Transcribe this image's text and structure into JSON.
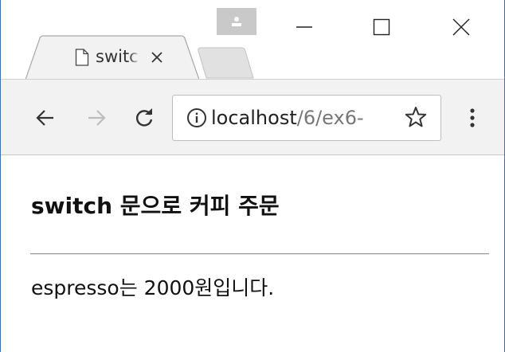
{
  "tab": {
    "title": "switch"
  },
  "address_bar": {
    "host": "localhost",
    "path": "/6/ex6-"
  },
  "page": {
    "heading": "switch 문으로 커피 주문",
    "result": "espresso는 2000원입니다."
  },
  "colors": {
    "window_border": "#3c6fb5",
    "toolbar_bg": "#f2f2f2",
    "avatar_bg": "#c9c9c9",
    "inactive_tab_bg": "#e1e1e1"
  },
  "icons": {
    "avatar": "person-icon",
    "minimize": "minimize-icon",
    "maximize": "maximize-icon",
    "close": "close-icon",
    "favicon": "document-icon",
    "tab_close": "close-icon",
    "back": "back-arrow-icon",
    "forward": "forward-arrow-icon",
    "reload": "reload-icon",
    "site_info": "info-icon",
    "bookmark": "star-icon",
    "menu": "kebab-menu-icon"
  }
}
